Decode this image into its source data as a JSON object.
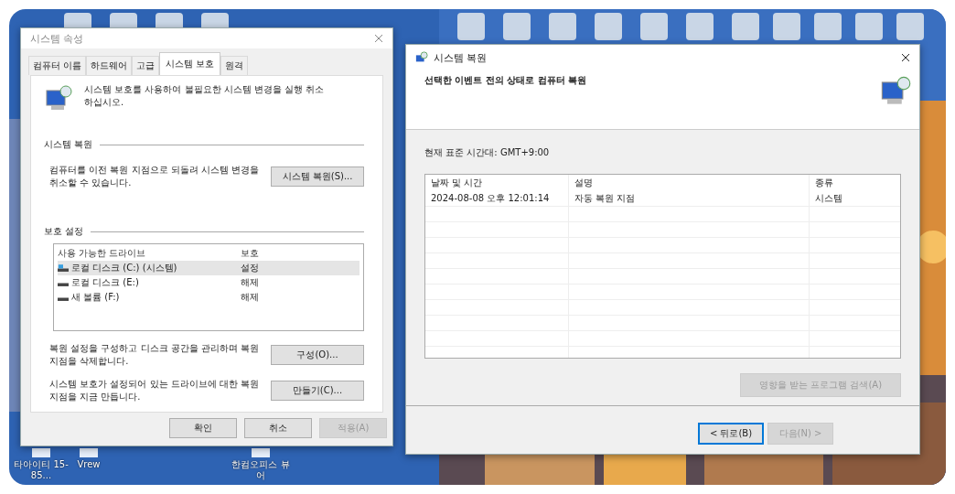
{
  "desktop": {
    "icons": [
      {
        "label": "타아이티 15-85..."
      },
      {
        "label": "Vrew"
      },
      {
        "label": "한컴오피스 뷰어"
      }
    ]
  },
  "system_properties": {
    "title": "시스템 속성",
    "tabs": [
      {
        "label": "컴퓨터 이름",
        "selected": false
      },
      {
        "label": "하드웨어",
        "selected": false
      },
      {
        "label": "고급",
        "selected": false
      },
      {
        "label": "시스템 보호",
        "selected": true
      },
      {
        "label": "원격",
        "selected": false
      }
    ],
    "intro": "시스템 보호를 사용하여 불필요한 시스템 변경을 실행 취소하십시오.",
    "restore": {
      "heading": "시스템 복원",
      "description": "컴퓨터를 이전 복원 지점으로 되돌려 시스템 변경을 취소할 수 있습니다.",
      "button": "시스템 복원(S)..."
    },
    "protection": {
      "heading": "보호 설정",
      "columns": [
        "사용 가능한 드라이브",
        "보호"
      ],
      "drives": [
        {
          "name": "로컬 디스크 (C:) (시스템)",
          "protection": "설정",
          "kind": "system",
          "selected": true
        },
        {
          "name": "로컬 디스크 (E:)",
          "protection": "해제",
          "kind": "disk",
          "selected": false
        },
        {
          "name": "새 볼륨 (F:)",
          "protection": "해제",
          "kind": "disk",
          "selected": false
        }
      ],
      "actions": [
        {
          "description": "복원 설정을 구성하고 디스크 공간을 관리하며 복원 지점을 삭제합니다.",
          "button": "구성(O)..."
        },
        {
          "description": "시스템 보호가 설정되어 있는 드라이브에 대한 복원 지점을 지금 만듭니다.",
          "button": "만들기(C)..."
        }
      ]
    },
    "buttons": [
      {
        "label": "확인",
        "disabled": false
      },
      {
        "label": "취소",
        "disabled": false
      },
      {
        "label": "적용(A)",
        "disabled": true
      }
    ]
  },
  "system_restore": {
    "title": "시스템 복원",
    "heading": "선택한 이벤트 전의 상태로 컴퓨터 복원",
    "timezone": "현재 표준 시간대: GMT+9:00",
    "columns": [
      "날짜 및 시간",
      "설명",
      "종류"
    ],
    "rows": [
      {
        "date": "2024-08-08 오후 12:01:14",
        "description": "자동 복원 지점",
        "type": "시스템",
        "selected": false
      }
    ],
    "scan_button": {
      "label": "영향을 받는 프로그램 검색(A)",
      "disabled": true
    },
    "buttons": [
      {
        "label": "< 뒤로(B)",
        "disabled": false,
        "focused": true
      },
      {
        "label": "다음(N) >",
        "disabled": true,
        "focused": false
      }
    ]
  }
}
